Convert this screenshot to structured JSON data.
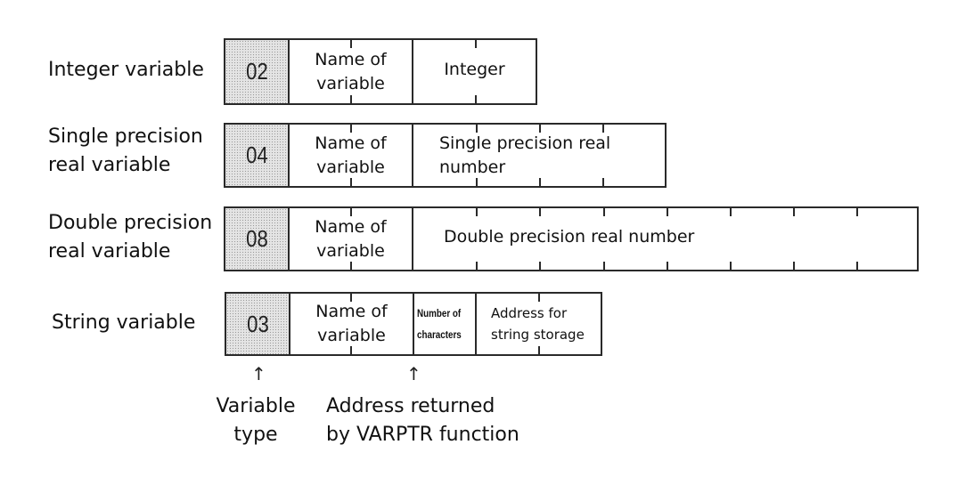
{
  "rows": [
    {
      "label": [
        "Integer variable"
      ],
      "type_code": "02",
      "name_cell": [
        "Name of",
        "variable"
      ],
      "value_cell": [
        "Integer"
      ]
    },
    {
      "label": [
        "Single precision",
        "real variable"
      ],
      "type_code": "04",
      "name_cell": [
        "Name of",
        "variable"
      ],
      "value_cell": [
        "Single precision real",
        "number"
      ]
    },
    {
      "label": [
        "Double precision",
        "real variable"
      ],
      "type_code": "08",
      "name_cell": [
        "Name of",
        "variable"
      ],
      "value_cell": [
        "Double precision real number"
      ]
    },
    {
      "label": [
        "String variable"
      ],
      "type_code": "03",
      "name_cell": [
        "Name of",
        "variable"
      ],
      "count_cell": [
        "Number of",
        "characters"
      ],
      "value_cell": [
        "Address for",
        "string storage"
      ]
    }
  ],
  "annotations": {
    "variable_type": [
      "Variable",
      "type"
    ],
    "varptr_address": [
      "Address returned",
      "by VARPTR function"
    ],
    "arrow_glyph": "↑"
  }
}
